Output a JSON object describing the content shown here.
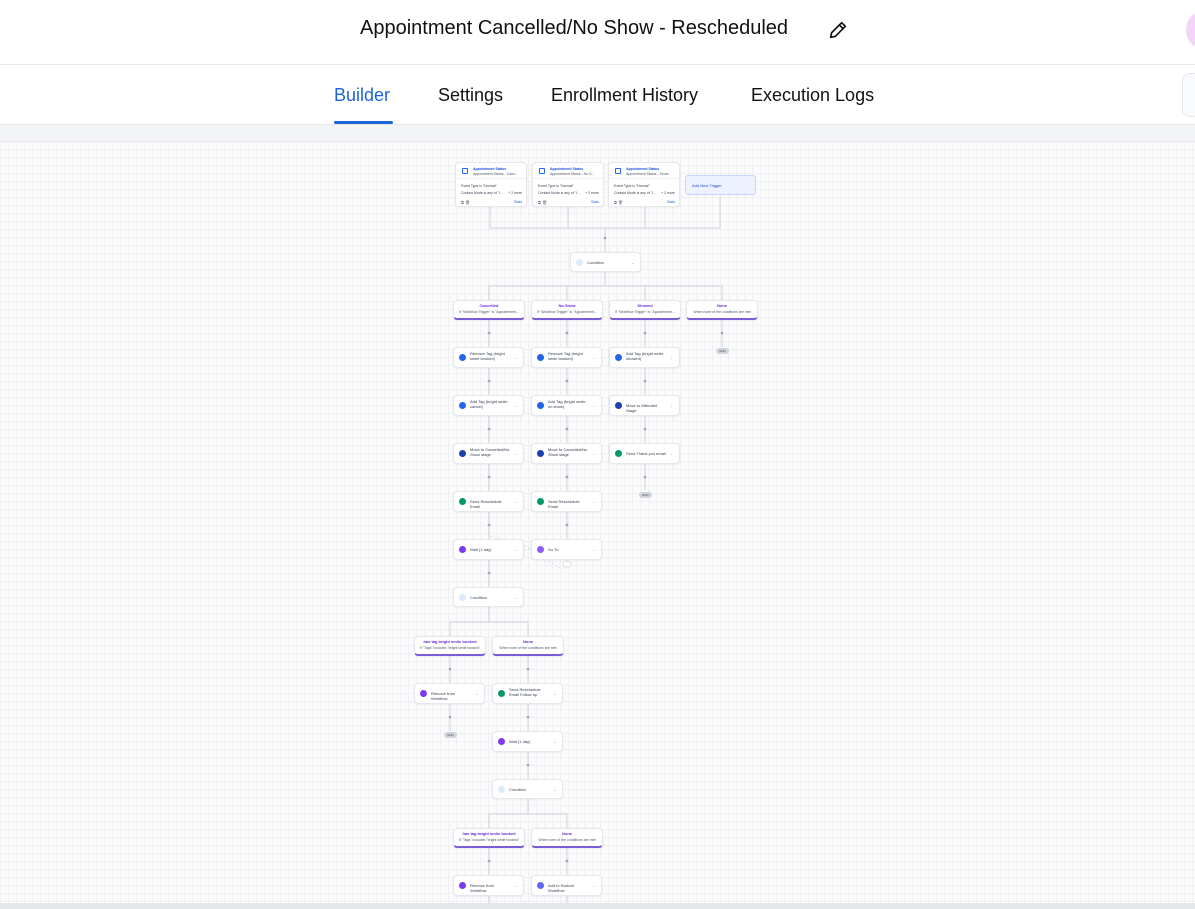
{
  "header": {
    "title": "Appointment Cancelled/No Show - Rescheduled"
  },
  "tabs": [
    {
      "label": "Builder",
      "active": true
    },
    {
      "label": "Settings",
      "active": false
    },
    {
      "label": "Enrollment History",
      "active": false
    },
    {
      "label": "Execution Logs",
      "active": false
    }
  ],
  "colors": {
    "accent": "#1d64d8",
    "branch": "#7c5cd6"
  },
  "triggers": [
    {
      "title": "Appointment Status",
      "subtitle": "Appointment Status - Canc...",
      "line1": "Event Type is \"Normal\"",
      "line2": "Contact Mode is any of \"I...",
      "more": "+ 2 more",
      "stats": "Stats"
    },
    {
      "title": "Appointment Status",
      "subtitle": "Appointment Status - No S...",
      "line1": "Event Type is \"Normal\"",
      "line2": "Contact Mode is any of \"I...",
      "more": "+ 2 more",
      "stats": "Stats"
    },
    {
      "title": "Appointment Status",
      "subtitle": "Appointment Status - Show...",
      "line1": "Event Type is \"Normal\"",
      "line2": "Contact Mode is any of \"I...",
      "more": "+ 2 more",
      "stats": "Stats"
    }
  ],
  "add_trigger": {
    "label": "Add New Trigger"
  },
  "nodes": {
    "condition1": "Condition",
    "condition2": "Condition",
    "condition3": "Condition",
    "a_cancel_1": "Remove Tag (bright smile booked)",
    "a_cancel_2": "Add Tag (bright smile cancel)",
    "a_cancel_3": "Move to Cancelled/No Show stage",
    "a_cancel_4": "Send Reschedule Email",
    "a_cancel_5": "Wait (1 day)",
    "a_noshow_1": "Remove Tag (bright smile booked)",
    "a_noshow_2": "Add Tag (bright smile no show)",
    "a_noshow_3": "Move to Cancelled/No Show stage",
    "a_noshow_4": "Send Reschedule Email",
    "a_noshow_5": "Go To",
    "a_showed_1": "Add Tag (bright smile showed)",
    "a_showed_2": "Move to Attended Stage",
    "a_showed_3": "Send Thank you email",
    "c2_yes_1": "Remove from Workflow",
    "c2_none_1": "Send Reschedule Email Follow up",
    "c2_none_2": "Wait (1 day)",
    "c3_yes_1": "Remove from Workflow",
    "c3_none_1": "Add to Nurture Workflow"
  },
  "branches": {
    "b_cancelled": {
      "title": "Cancelled",
      "sub": "If \"Workflow Trigger\" is \"Appointment..."
    },
    "b_noshow": {
      "title": "No Show",
      "sub": "If \"Workflow Trigger\" is \"Appointment..."
    },
    "b_showed": {
      "title": "Showed",
      "sub": "If \"Workflow Trigger\" is \"Appointment..."
    },
    "b_none1": {
      "title": "None",
      "sub": "When none of the conditions are met"
    },
    "b_c2_yes": {
      "title": "has tag bright smile booked",
      "sub": "If \"Tags\" includes \"bright smile booked\""
    },
    "b_c2_none": {
      "title": "None",
      "sub": "When none of the conditions are met"
    },
    "b_c3_yes": {
      "title": "has tag bright smile booked",
      "sub": "If \"Tags\" includes \"bright smile booked\""
    },
    "b_c3_none": {
      "title": "None",
      "sub": "When none of the conditions are met"
    }
  },
  "end_label": "END"
}
